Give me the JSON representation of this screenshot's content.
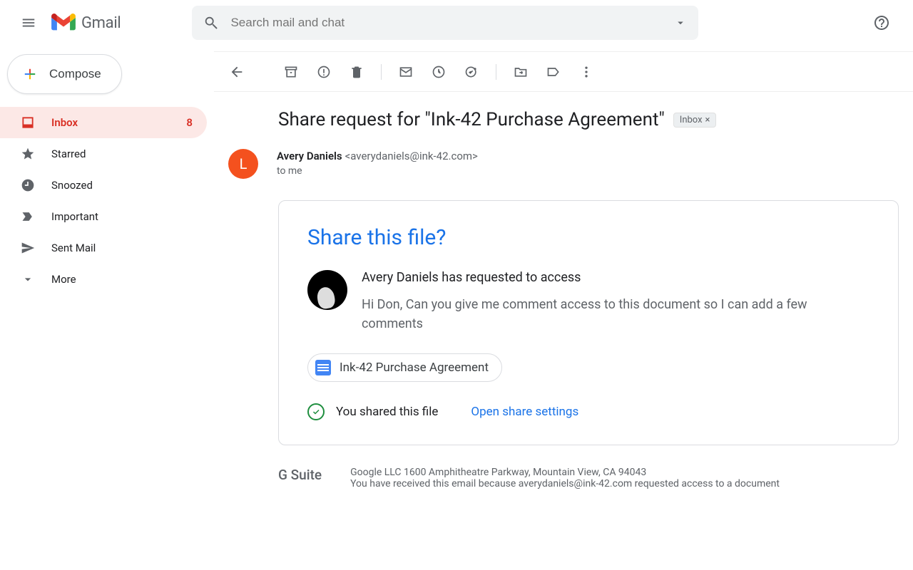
{
  "header": {
    "app_name": "Gmail",
    "search_placeholder": "Search mail and chat"
  },
  "compose_label": "Compose",
  "sidebar": {
    "items": [
      {
        "label": "Inbox",
        "badge": "8",
        "icon": "inbox"
      },
      {
        "label": "Starred",
        "icon": "star"
      },
      {
        "label": "Snoozed",
        "icon": "clock"
      },
      {
        "label": "Important",
        "icon": "important"
      },
      {
        "label": "Sent Mail",
        "icon": "send"
      },
      {
        "label": "More",
        "icon": "expand"
      }
    ]
  },
  "message": {
    "subject": "Share request for \"Ink-42 Purchase Agreement\"",
    "label": "Inbox",
    "sender_name": "Avery Daniels",
    "sender_email": "<averydaniels@ink-42.com>",
    "to_line": "to me",
    "avatar_initial": "L"
  },
  "card": {
    "title": "Share this file?",
    "request_line": "Avery Daniels has requested to access",
    "request_message": "Hi Don, Can you give me comment access to this document so I can add a few comments",
    "file_name": "Ink-42 Purchase Agreement",
    "status_text": "You shared this file",
    "settings_link": "Open share settings"
  },
  "footer": {
    "brand": "G Suite",
    "address": "Google LLC 1600 Amphitheatre Parkway, Mountain View, CA 94043",
    "reason": "You have received this email because averydaniels@ink-42.com requested access to a document"
  }
}
